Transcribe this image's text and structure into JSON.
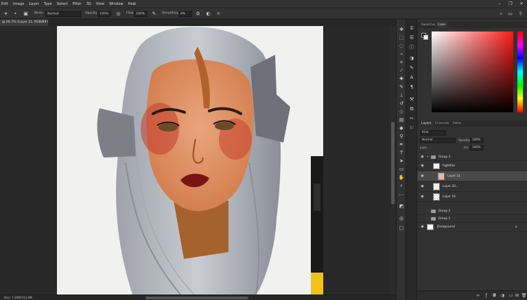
{
  "menu": [
    "Edit",
    "Image",
    "Layer",
    "Type",
    "Select",
    "Filter",
    "3D",
    "View",
    "Window",
    "Help"
  ],
  "options_bar": {
    "mode_label": "Mode:",
    "mode_value": "Normal",
    "opacity_label": "Opacity:",
    "opacity_value": "100%",
    "flow_label": "Flow:",
    "flow_value": "100%",
    "smoothing_label": "Smoothing:",
    "smoothing_value": "0%"
  },
  "document": {
    "tab_title": "@ 66.7% (Layer 21, RGB/8#) *",
    "status": "Doc: 7.20M/153.4M"
  },
  "panels": {
    "color_tabs": [
      "Swatches",
      "Color"
    ],
    "layer_tabs": [
      "Layers",
      "Channels",
      "Paths"
    ],
    "kind_label": "Kind",
    "blend_mode": "Normal",
    "opacity_label": "Opacity:",
    "opacity_value": "100%",
    "lock_label": "Lock:",
    "fill_label": "Fill:",
    "fill_value": "100%"
  },
  "layers": [
    {
      "name": "Group 3",
      "type": "group",
      "open": true
    },
    {
      "name": "hightlite",
      "type": "layer"
    },
    {
      "name": "Layer 21",
      "type": "layer",
      "selected": true
    },
    {
      "name": "Layer 20...",
      "type": "layer"
    },
    {
      "name": "Layer 16",
      "type": "layer"
    },
    {
      "name": "Group 2",
      "type": "group"
    },
    {
      "name": "Group 1",
      "type": "group"
    },
    {
      "name": "Background",
      "type": "background"
    }
  ],
  "colors": {
    "accent": "#4a4a4a",
    "foreground": "#111111",
    "background": "#ffffff"
  }
}
